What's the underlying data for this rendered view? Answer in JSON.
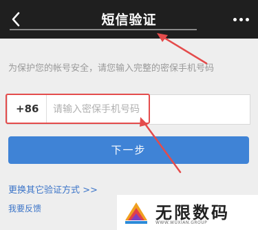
{
  "header": {
    "title": "短信验证",
    "back_icon": "chevron-left-icon",
    "more_icon": "more-dots-icon"
  },
  "hint_text": "为保护您的帐号安全，请您输入完整的密保手机号码",
  "phone_field": {
    "prefix": "+86",
    "placeholder": "请输入密保手机号码",
    "value": ""
  },
  "next_button": {
    "label": "下一步"
  },
  "switch_link": "更换其它验证方式 >>",
  "feedback_link": "我要反馈",
  "watermark": {
    "text": "无限数码",
    "subtext": "WWW.WUXIAN.GROUP"
  },
  "colors": {
    "topbar": "#1f1f1f",
    "button": "#3f83d6",
    "link": "#3b74c8",
    "annotation": "#e44b4b"
  }
}
